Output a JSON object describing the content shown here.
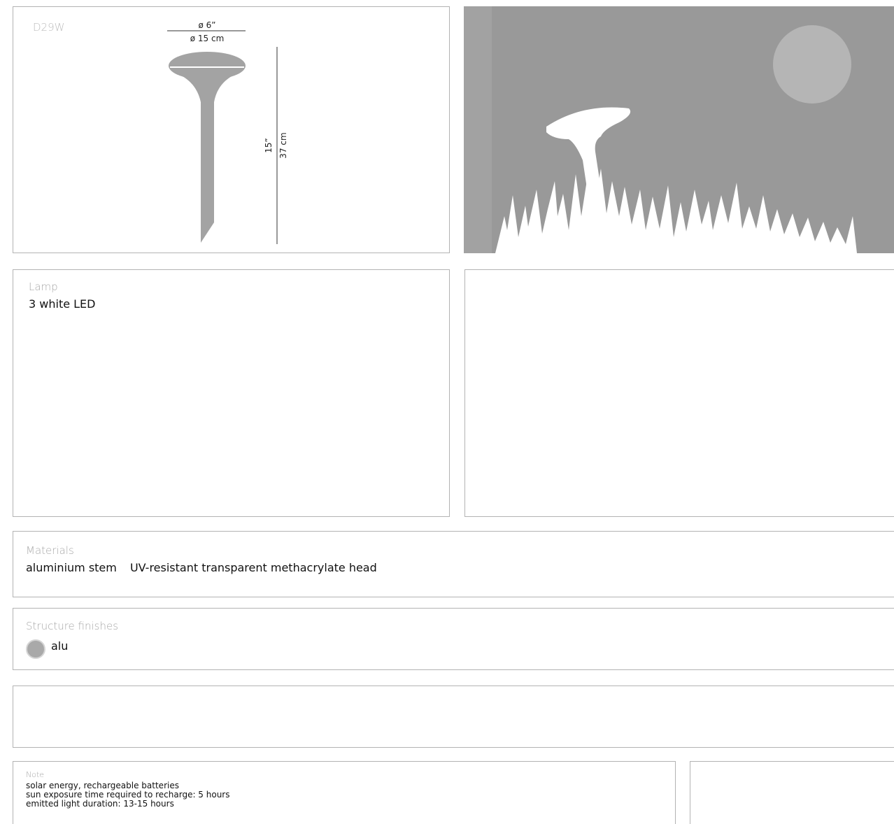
{
  "product_code": "D29W",
  "dimensions": {
    "diameter_in": "ø 6ˮ",
    "diameter_cm": "ø 15 cm",
    "height_in": "15ˮ",
    "height_cm": "37 cm"
  },
  "lamp": {
    "label": "Lamp",
    "value": "3 white LED"
  },
  "materials": {
    "label": "Materials",
    "items": [
      "aluminium stem",
      "UV-resistant transparent methacrylate head"
    ]
  },
  "structure_finishes": {
    "label": "Structure finishes",
    "items": [
      {
        "name": "alu",
        "color": "#a9a9a9"
      }
    ]
  },
  "note": {
    "label": "Note",
    "lines": [
      "solar energy, rechargeable batteries",
      "sun exposure time required to recharge: 5 hours",
      "emitted light duration: 13-15 hours"
    ]
  },
  "colors": {
    "border": "#b3b3b3",
    "label": "#a8a8a8",
    "photo_bg": "#999999"
  }
}
